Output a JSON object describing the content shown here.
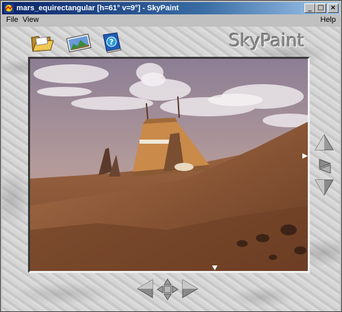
{
  "window": {
    "title": "mars_equirectangular [h=61° v=9°] - SkyPaint"
  },
  "menu": {
    "file": "File",
    "view": "View",
    "help": "Help"
  },
  "toolbar": {
    "brand": "SkyPaint",
    "icons": [
      "folder-open-icon",
      "landscape-image-icon",
      "help-book-icon"
    ]
  },
  "title_buttons": {
    "minimize": "_",
    "maximize": "□",
    "close": "×"
  },
  "navigation": {
    "heading_deg": 61,
    "pitch_deg": 9,
    "icons": [
      "up-arrow-icon",
      "rotate-icon",
      "down-arrow-icon",
      "left-arrow-icon",
      "move-cross-icon",
      "right-arrow-icon"
    ]
  }
}
